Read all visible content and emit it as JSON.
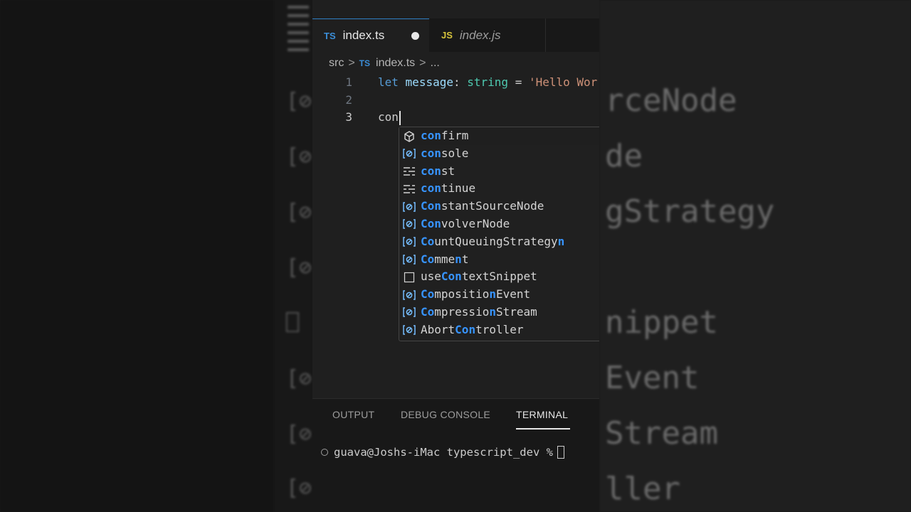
{
  "background_overlay": {
    "words": [
      "rceNode",
      "de",
      "gStrategy",
      "nippet",
      "Event",
      "Stream",
      "ller"
    ]
  },
  "tabs": [
    {
      "badge": "TS",
      "label": "index.ts",
      "modified": true
    },
    {
      "badge": "JS",
      "label": "index.js",
      "modified": false
    }
  ],
  "breadcrumb": {
    "folder": "src",
    "separator": ">",
    "badge": "TS",
    "file": "index.ts",
    "more": "..."
  },
  "code": {
    "line_numbers": [
      "1",
      "2",
      "3"
    ],
    "line1": {
      "keyword": "let",
      "identifier": "message",
      "colon": ":",
      "type": "string",
      "equals": "=",
      "string": "'Hello Wor"
    },
    "line3": {
      "typed": "con"
    }
  },
  "suggestions": [
    {
      "icon": "method-icon",
      "match": "con",
      "rest": "firm",
      "pre": ""
    },
    {
      "icon": "variable-icon",
      "match": "con",
      "rest": "sole",
      "pre": ""
    },
    {
      "icon": "keyword-icon",
      "match": "con",
      "rest": "st",
      "pre": ""
    },
    {
      "icon": "keyword-icon",
      "match": "con",
      "rest": "tinue",
      "pre": ""
    },
    {
      "icon": "variable-icon",
      "match": "Con",
      "rest": "stantSourceNode",
      "pre": ""
    },
    {
      "icon": "variable-icon",
      "match": "Con",
      "rest": "volverNode",
      "pre": ""
    },
    {
      "icon": "variable-icon",
      "match": "Co",
      "rest": "untQueuingStrategy",
      "pre": "",
      "extra_hl": "n"
    },
    {
      "icon": "variable-icon",
      "match": "Co",
      "rest": "mme",
      "pre": "",
      "extra_hl": "n",
      "tail": "t"
    },
    {
      "icon": "snippet-icon",
      "pre": "use",
      "match": "Con",
      "rest": "textSnippet"
    },
    {
      "icon": "variable-icon",
      "match": "Co",
      "rest": "mpositio",
      "pre": "",
      "extra_hl": "n",
      "tail": "Event"
    },
    {
      "icon": "variable-icon",
      "match": "Co",
      "rest": "mpressio",
      "pre": "",
      "extra_hl": "n",
      "tail": "Stream"
    },
    {
      "icon": "variable-icon",
      "pre": "Abort",
      "match": "Con",
      "rest": "troller"
    }
  ],
  "panel": {
    "tabs": [
      "OUTPUT",
      "DEBUG CONSOLE",
      "TERMINAL"
    ],
    "active_tab": "TERMINAL",
    "prompt": "guava@Joshs-iMac typescript_dev %"
  },
  "colors": {
    "editor_bg": "#1f1f1f",
    "accent": "#3794ff",
    "keyword": "#569cd6",
    "type": "#4ec9b0",
    "string": "#ce9178"
  }
}
